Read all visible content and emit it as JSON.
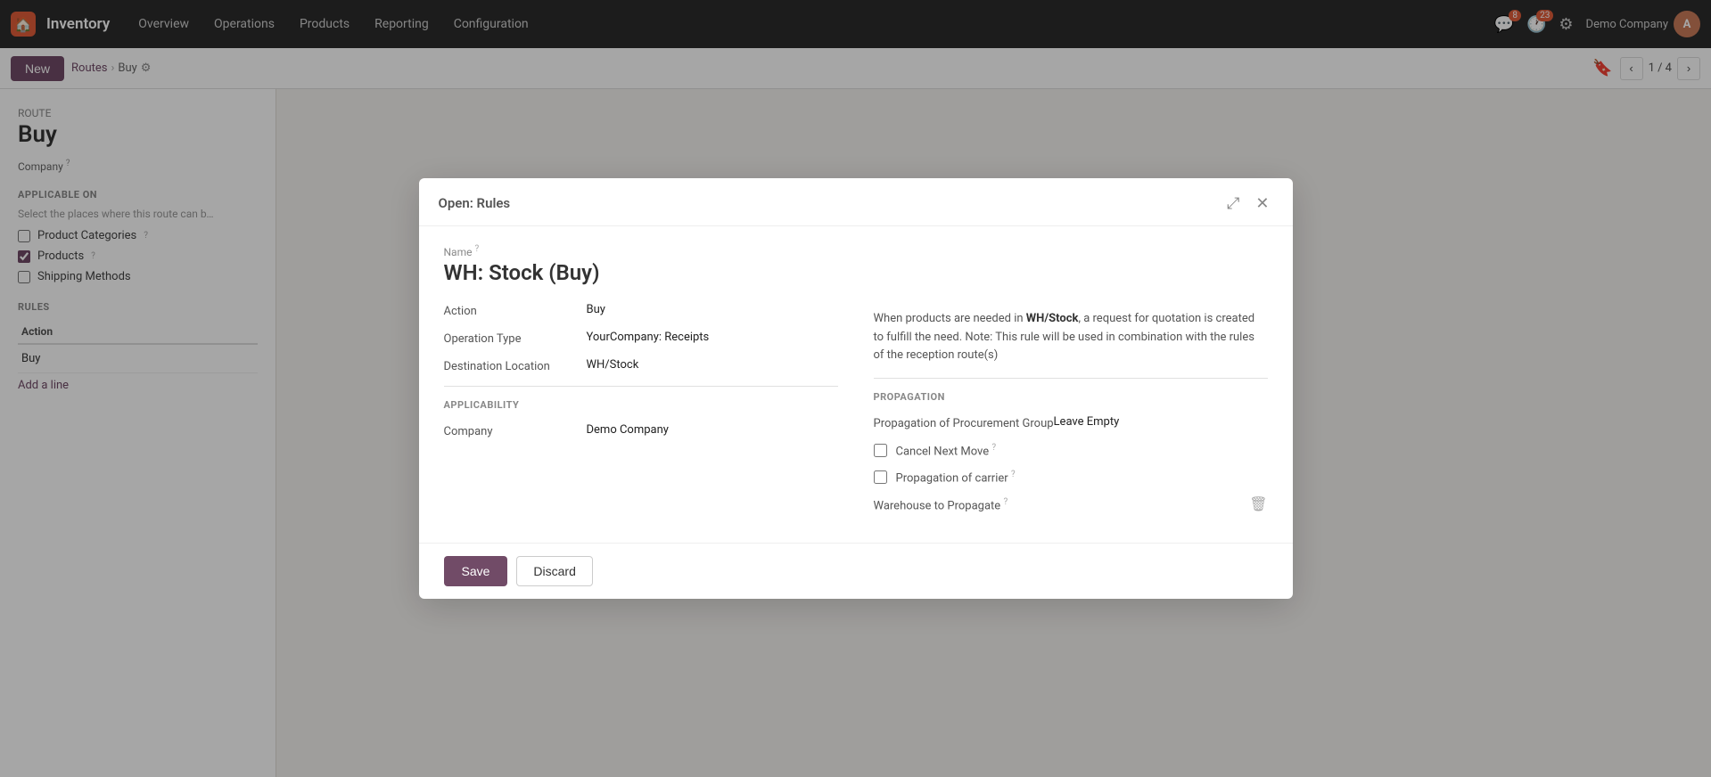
{
  "app": {
    "name": "Inventory",
    "logo_char": "🏠"
  },
  "topnav": {
    "items": [
      "Overview",
      "Operations",
      "Products",
      "Reporting",
      "Configuration"
    ],
    "notif1_count": "8",
    "notif2_count": "23",
    "company": "Demo Company",
    "user_initials": "A"
  },
  "toolbar": {
    "new_label": "New",
    "breadcrumb_parent": "Routes",
    "breadcrumb_current": "Buy",
    "pager": "1 / 4"
  },
  "left_panel": {
    "route_label": "Route",
    "route_title": "Buy",
    "company_label": "Company",
    "applicable_on_header": "APPLICABLE ON",
    "applicable_on_desc": "Select the places where this route can b…",
    "product_categories_label": "Product Categories",
    "products_label": "Products",
    "products_checked": true,
    "shipping_methods_label": "Shipping Methods",
    "shipping_methods_checked": false,
    "rules_header": "RULES",
    "rules_col": "Action",
    "rules_row": "Buy",
    "add_line": "Add a line"
  },
  "modal": {
    "title": "Open: Rules",
    "name_label": "Name",
    "name_value": "WH: Stock (Buy)",
    "action_label": "Action",
    "action_value": "Buy",
    "operation_type_label": "Operation Type",
    "operation_type_value": "YourCompany: Receipts",
    "destination_location_label": "Destination Location",
    "destination_location_value": "WH/Stock",
    "applicability_label": "APPLICABILITY",
    "company_label": "Company",
    "company_value": "Demo Company",
    "info_text_part1": "When products are needed in ",
    "info_text_bold": "WH/Stock",
    "info_text_part2": ", a request for quotation is created to fulfill the need. Note: This rule will be used in combination with the rules of the reception route(s)",
    "propagation_label": "PROPAGATION",
    "propagation_procurement_group_label": "Propagation of Procurement Group",
    "propagation_procurement_group_value": "Leave Empty",
    "cancel_next_move_label": "Cancel Next Move",
    "cancel_next_move_checked": false,
    "propagation_carrier_label": "Propagation of carrier",
    "propagation_carrier_checked": false,
    "warehouse_to_propagate_label": "Warehouse to Propagate",
    "save_label": "Save",
    "discard_label": "Discard"
  }
}
